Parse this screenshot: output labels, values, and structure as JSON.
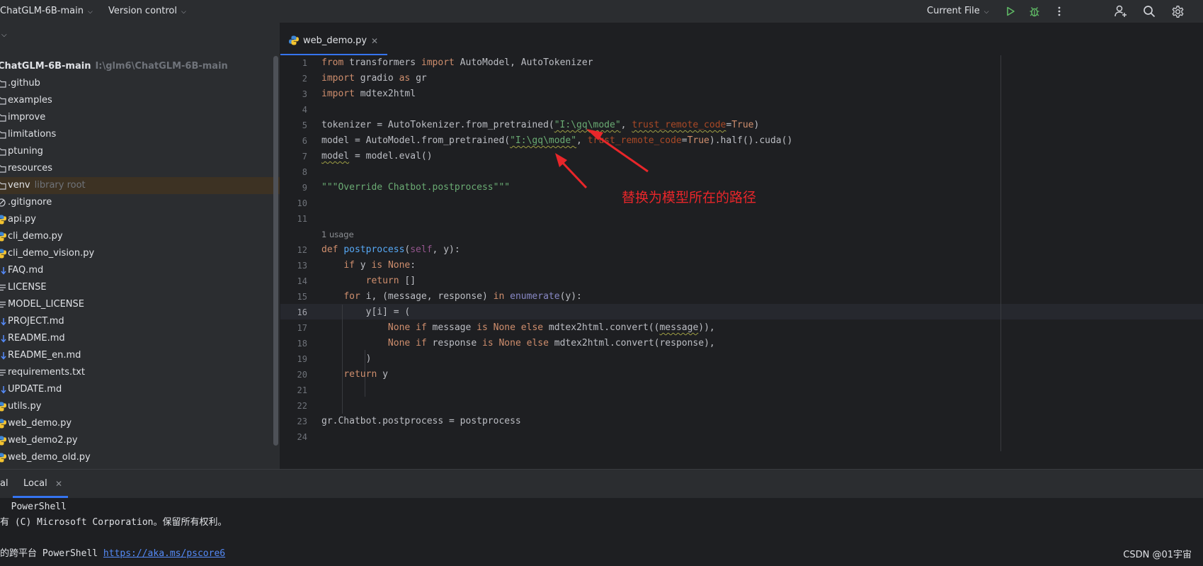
{
  "topbar": {
    "project_name": "ChatGLM-6B-main",
    "vcs": "Version control",
    "run_config": "Current File"
  },
  "project_tree": {
    "root": {
      "name": "ChatGLM-6B-main",
      "path": "I:\\glm6\\ChatGLM-6B-main"
    },
    "items": [
      {
        "label": ".github",
        "icon": "folder-icon"
      },
      {
        "label": "examples",
        "icon": "folder-icon"
      },
      {
        "label": "improve",
        "icon": "folder-icon"
      },
      {
        "label": "limitations",
        "icon": "folder-icon"
      },
      {
        "label": "ptuning",
        "icon": "folder-icon"
      },
      {
        "label": "resources",
        "icon": "folder-icon"
      },
      {
        "label": "venv",
        "hint": "library root",
        "icon": "folder-icon",
        "selected": true
      },
      {
        "label": ".gitignore",
        "icon": "ignore-file-icon"
      },
      {
        "label": "api.py",
        "icon": "python-file-icon"
      },
      {
        "label": "cli_demo.py",
        "icon": "python-file-icon"
      },
      {
        "label": "cli_demo_vision.py",
        "icon": "python-file-icon"
      },
      {
        "label": "FAQ.md",
        "icon": "markdown-file-icon"
      },
      {
        "label": "LICENSE",
        "icon": "text-file-icon"
      },
      {
        "label": "MODEL_LICENSE",
        "icon": "text-file-icon"
      },
      {
        "label": "PROJECT.md",
        "icon": "markdown-file-icon"
      },
      {
        "label": "README.md",
        "icon": "markdown-file-icon"
      },
      {
        "label": "README_en.md",
        "icon": "markdown-file-icon"
      },
      {
        "label": "requirements.txt",
        "icon": "text-file-icon"
      },
      {
        "label": "UPDATE.md",
        "icon": "markdown-file-icon"
      },
      {
        "label": "utils.py",
        "icon": "python-file-icon"
      },
      {
        "label": "web_demo.py",
        "icon": "python-file-icon"
      },
      {
        "label": "web_demo2.py",
        "icon": "python-file-icon"
      },
      {
        "label": "web_demo_old.py",
        "icon": "python-file-icon"
      }
    ]
  },
  "editor": {
    "active_tab": "web_demo.py",
    "usage_hint": "1 usage",
    "current_line": 16,
    "line_numbers": [
      "1",
      "2",
      "3",
      "4",
      "5",
      "6",
      "7",
      "8",
      "9",
      "10",
      "11",
      "12",
      "13",
      "14",
      "15",
      "16",
      "17",
      "18",
      "19",
      "20",
      "21",
      "22",
      "23",
      "24"
    ],
    "annotation": "替换为模型所在的路径"
  },
  "terminal": {
    "tab_prefix": "al",
    "tab_local": "Local",
    "lines": {
      "l1": "  PowerShell",
      "l2": "有 (C) Microsoft Corporation。保留所有权利。",
      "l3_prefix": "的跨平台 PowerShell ",
      "l3_link": "https://aka.ms/pscore6"
    }
  },
  "watermark": "CSDN @01宇宙",
  "colors": {
    "accent": "#3574f0",
    "annotation_red": "#e8262a"
  }
}
